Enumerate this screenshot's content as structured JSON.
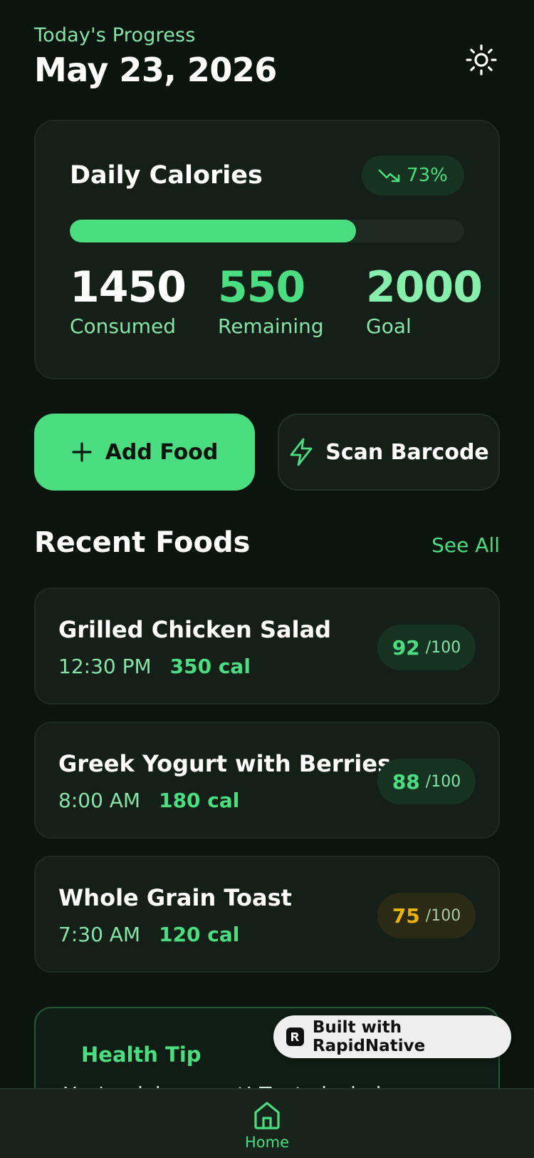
{
  "header": {
    "subtitle": "Today's Progress",
    "date": "May 23, 2026",
    "theme_icon": "sun-icon"
  },
  "calories": {
    "title": "Daily Calories",
    "trend_label": "73%",
    "trend_icon": "trending-down-icon",
    "progress_fraction": 0.725,
    "consumed_value": "1450",
    "consumed_label": "Consumed",
    "remaining_value": "550",
    "remaining_label": "Remaining",
    "goal_value": "2000",
    "goal_label": "Goal"
  },
  "actions": {
    "add_food": "Add Food",
    "add_icon": "plus-icon",
    "scan_barcode": "Scan Barcode",
    "scan_icon": "lightning-icon"
  },
  "recent": {
    "title": "Recent Foods",
    "see_all": "See All",
    "items": [
      {
        "name": "Grilled Chicken Salad",
        "time": "12:30 PM",
        "calories": "350 cal",
        "score": "92",
        "score_max": "/100",
        "status": "good"
      },
      {
        "name": "Greek Yogurt with Berries",
        "time": "8:00 AM",
        "calories": "180 cal",
        "score": "88",
        "score_max": "/100",
        "status": "good"
      },
      {
        "name": "Whole Grain Toast",
        "time": "7:30 AM",
        "calories": "120 cal",
        "score": "75",
        "score_max": "/100",
        "status": "warn"
      }
    ]
  },
  "tip": {
    "title": "Health Tip",
    "text": "You're doing great! Try to include more"
  },
  "badge": {
    "label": "Built with RapidNative"
  },
  "tabbar": {
    "home_label": "Home",
    "home_icon": "home-icon"
  },
  "colors": {
    "background": "#0b140e",
    "card": "#141f18",
    "accent": "#4ade80",
    "muted_text": "#86e3a6",
    "warning": "#eab308"
  }
}
